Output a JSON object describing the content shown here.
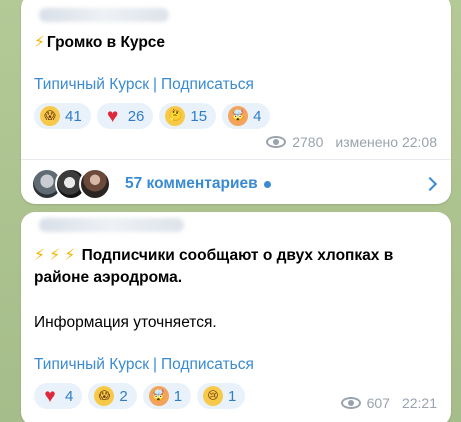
{
  "posts": [
    {
      "text_prefix": "⚡",
      "text": "Громко в Курсе",
      "channel_link": "Типичный Курск",
      "subscribe_link": "Подписаться",
      "separator": "|",
      "reactions": [
        {
          "emoji": "face-screaming-icon",
          "count": "41"
        },
        {
          "emoji": "red-heart-icon",
          "count": "26"
        },
        {
          "emoji": "thinking-face-icon",
          "count": "15"
        },
        {
          "emoji": "exploding-head-icon",
          "count": "4"
        }
      ],
      "views": "2780",
      "edited_time": "изменено 22:08",
      "comments": "57 комментариев"
    },
    {
      "text_prefix": "⚡ ⚡ ⚡",
      "headline": "Подписчики сообщают о двух хлопках в районе аэродрома.",
      "body": "Информация уточняется.",
      "channel_link": "Типичный Курск",
      "subscribe_link": "Подписаться",
      "separator": "|",
      "reactions": [
        {
          "emoji": "red-heart-icon",
          "count": "4"
        },
        {
          "emoji": "face-screaming-icon",
          "count": "2"
        },
        {
          "emoji": "exploding-head-icon",
          "count": "1"
        },
        {
          "emoji": "crying-face-icon",
          "count": "1"
        }
      ],
      "views": "607",
      "time": "22:21"
    }
  ],
  "colors": {
    "link": "#3a8bd2",
    "reaction_bg": "#e9f2fb",
    "meta": "#9aa3ad",
    "background": "#a9c18f"
  }
}
